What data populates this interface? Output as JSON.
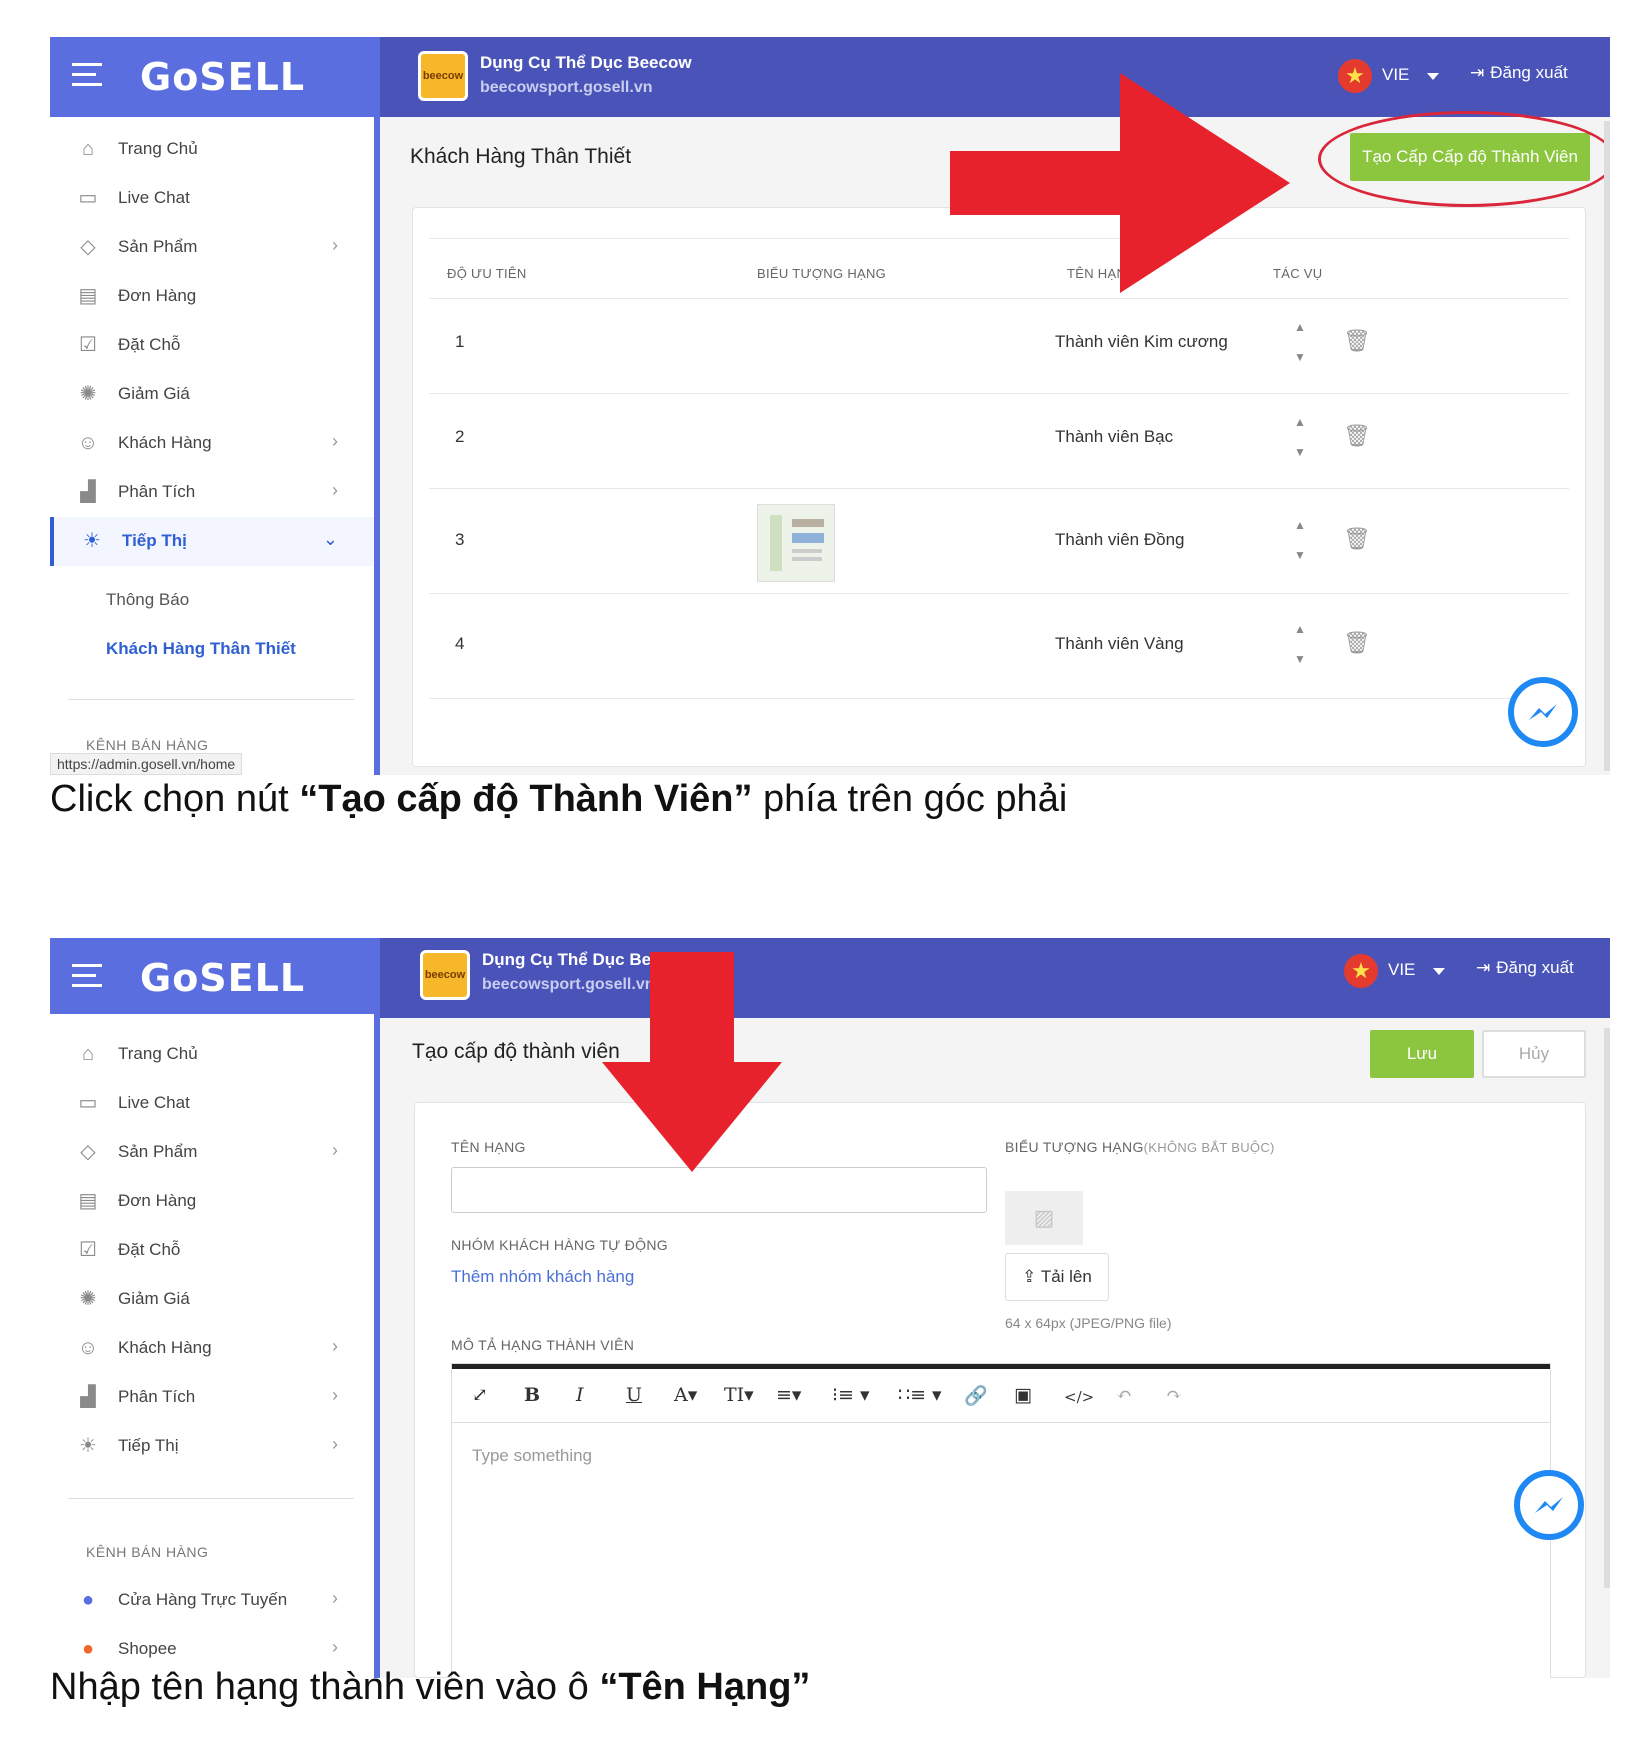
{
  "brand": {
    "logo": "GoSELL"
  },
  "store": {
    "icon_label": "beecow",
    "name": "Dụng Cụ Thể Dục Beecow",
    "url": "beecowsport.gosell.vn"
  },
  "header": {
    "language": "VIE",
    "logout_label": "Đăng xuất"
  },
  "sidebar": {
    "items": [
      {
        "label": "Trang Chủ",
        "icon": "home-icon"
      },
      {
        "label": "Live Chat",
        "icon": "chat-icon"
      },
      {
        "label": "Sản Phẩm",
        "icon": "tag-icon"
      },
      {
        "label": "Đơn Hàng",
        "icon": "order-icon"
      },
      {
        "label": "Đặt Chỗ",
        "icon": "calendar-icon"
      },
      {
        "label": "Giảm Giá",
        "icon": "discount-icon"
      },
      {
        "label": "Khách Hàng",
        "icon": "customers-icon"
      },
      {
        "label": "Phân Tích",
        "icon": "chart-icon"
      },
      {
        "label": "Tiếp Thị",
        "icon": "lightbulb-icon"
      }
    ],
    "sub_items": [
      "Thông Báo",
      "Khách Hàng Thân Thiết"
    ],
    "section_label": "KÊNH BÁN HÀNG",
    "channels": [
      {
        "label": "Cửa Hàng Trực Tuyến",
        "icon": "store-icon"
      },
      {
        "label": "Shopee",
        "icon": "shopee-icon"
      }
    ],
    "status_url": "https://admin.gosell.vn/home"
  },
  "screen1": {
    "title": "Khách Hàng Thân Thiết",
    "create_button": "Tạo Cấp Cấp độ Thành Viên",
    "columns": [
      "ĐỘ ƯU TIÊN",
      "BIỂU TƯỢNG HẠNG",
      "TÊN HẠNG",
      "TÁC VỤ"
    ],
    "rows": [
      {
        "priority": "1",
        "name": "Thành viên Kim cương",
        "has_icon": false
      },
      {
        "priority": "2",
        "name": "Thành viên Bạc",
        "has_icon": false
      },
      {
        "priority": "3",
        "name": "Thành viên Đồng",
        "has_icon": true
      },
      {
        "priority": "4",
        "name": "Thành viên Vàng",
        "has_icon": false
      }
    ],
    "caption_pre": "Click chọn nút ",
    "caption_bold": "“Tạo cấp độ Thành Viên”",
    "caption_post": " phía trên góc phải"
  },
  "screen2": {
    "title": "Tạo cấp độ thành viên",
    "save": "Lưu",
    "cancel": "Hủy",
    "name_label": "TÊN HẠNG",
    "icon_label": "BIỂU TƯỢNG HẠNG",
    "icon_optional": "(KHÔNG BẮT BUỘC)",
    "group_label": "NHÓM KHÁCH HÀNG TỰ ĐỘNG",
    "group_link": "Thêm nhóm khách hàng",
    "upload": "Tải lên",
    "upload_hint": "64 x 64px (JPEG/PNG file)",
    "desc_label": "MÔ TẢ HẠNG THÀNH VIÊN",
    "editor_placeholder": "Type something",
    "caption_pre": "Nhập tên hạng thành viên vào ô ",
    "caption_bold": "“Tên Hạng”"
  },
  "colors": {
    "header": "#4a54b8",
    "brand": "#5b6ee0",
    "accent_green": "#8cc63f",
    "arrow_red": "#e8222c",
    "link_blue": "#2f5fd3"
  }
}
